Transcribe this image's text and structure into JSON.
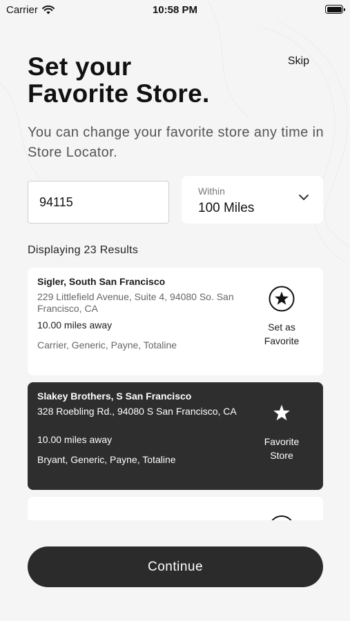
{
  "status_bar": {
    "carrier": "Carrier",
    "time": "10:58 PM"
  },
  "header": {
    "skip_label": "Skip",
    "title_line1": "Set your",
    "title_line2": "Favorite Store.",
    "subtitle": "You can change your favorite store any time in Store Locator."
  },
  "search": {
    "zip_value": "94115",
    "within_label": "Within",
    "within_value": "100 Miles"
  },
  "results": {
    "count_text": "Displaying 23 Results",
    "stores": [
      {
        "name": "Sigler, South San Francisco",
        "address": "229 Littlefield Avenue, Suite 4, 94080 So. San Francisco, CA",
        "distance": "10.00 miles away",
        "brands": "Carrier, Generic, Payne, Totaline",
        "favorite_line1": "Set as",
        "favorite_line2": "Favorite",
        "is_favorite": false
      },
      {
        "name": "Slakey Brothers, S San Francisco",
        "address": "328 Roebling Rd., 94080 S San Francisco, CA",
        "distance": "10.00 miles away",
        "brands": "Bryant, Generic, Payne, Totaline",
        "favorite_line1": "Favorite",
        "favorite_line2": "Store",
        "is_favorite": true
      }
    ]
  },
  "footer": {
    "continue_label": "Continue"
  },
  "colors": {
    "background": "#f5f5f5",
    "dark_card": "#2e2e2e",
    "button": "#2b2b2b"
  }
}
